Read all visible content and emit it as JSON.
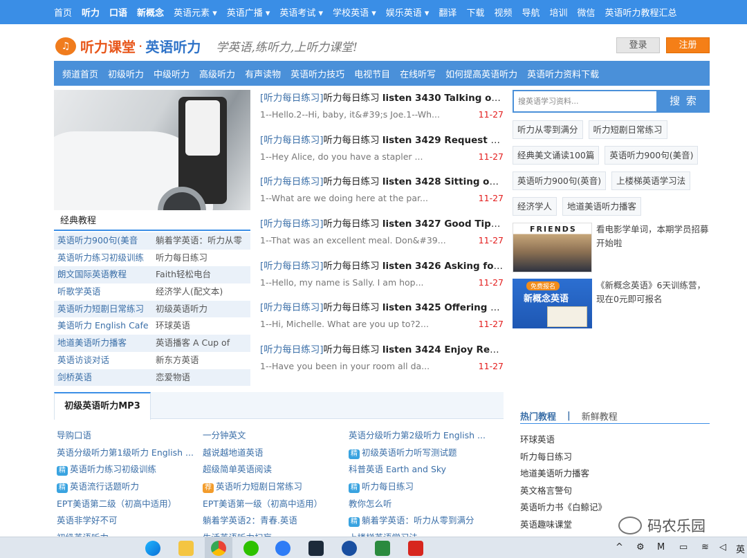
{
  "topnav": [
    "首页",
    "听力",
    "口语",
    "新概念",
    "英语元素 ▾",
    "英语广播 ▾",
    "英语考试 ▾",
    "学校英语 ▾",
    "娱乐英语 ▾",
    "翻译",
    "下载",
    "视频",
    "导航",
    "培训",
    "微信",
    "英语听力教程汇总"
  ],
  "logo": {
    "brand1": "听力课堂",
    "dot": "·",
    "brand2": "英语听力",
    "slogan": "学英语,练听力,上听力课堂!"
  },
  "auth": {
    "login": "登录",
    "register": "注册"
  },
  "channav": [
    "频道首页",
    "初级听力",
    "中级听力",
    "高级听力",
    "有声读物",
    "英语听力技巧",
    "电视节目",
    "在线听写",
    "如何提高英语听力",
    "英语听力资料下载"
  ],
  "classic": {
    "title": "经典教程",
    "rows": [
      [
        "英语听力900句(美音",
        "躺着学英语：听力从零"
      ],
      [
        "英语听力练习初级训练",
        "听力每日练习"
      ],
      [
        "朗文国际英语教程",
        "Faith轻松电台"
      ],
      [
        "听歌学英语",
        "经济学人(配文本)"
      ],
      [
        "英语听力短剧日常练习",
        "初级英语听力"
      ],
      [
        "美语听力 English Cafe",
        "环球英语"
      ],
      [
        "地道美语听力播客",
        "英语播客 A Cup of"
      ],
      [
        "英语访谈对话",
        "新东方英语"
      ],
      [
        "剑桥英语",
        "恋爱物语"
      ]
    ]
  },
  "news": [
    {
      "cat": "[听力每日练习]",
      "pre": "听力每日练习 ",
      "title": "listen 3430 Talking on t...",
      "sub": "1--Hello.2--Hi, baby, it&#39;s Joe.1--Wh...",
      "date": "11-27"
    },
    {
      "cat": "[听力每日练习]",
      "pre": "听力每日练习 ",
      "title": "listen 3429 Request for ...",
      "sub": "1--Hey Alice, do you have a stapler ...",
      "date": "11-27"
    },
    {
      "cat": "[听力每日练习]",
      "pre": "听力每日练习 ",
      "title": "listen 3428 Sitting on th...",
      "sub": "1--What are we doing here at the par...",
      "date": "11-27"
    },
    {
      "cat": "[听力每日练习]",
      "pre": "听力每日练习 ",
      "title": "listen 3427 Good Tips fo...",
      "sub": "1--That was an excellent meal. Don&#39...",
      "date": "11-27"
    },
    {
      "cat": "[听力每日练习]",
      "pre": "听力每日练习 ",
      "title": "listen 3426 Asking for H...",
      "sub": "1--Hello, my name is Sally. I am hop...",
      "date": "11-27"
    },
    {
      "cat": "[听力每日练习]",
      "pre": "听力每日练习 ",
      "title": "listen 3425 Offering Help",
      "sub": "1--Hi, Michelle. What are you up to?2...",
      "date": "11-27"
    },
    {
      "cat": "[听力每日练习]",
      "pre": "听力每日练习 ",
      "title": "listen 3424 Enjoy Reading",
      "sub": "1--Have you been in your room all da...",
      "date": "11-27"
    }
  ],
  "search": {
    "placeholder": "搜英语学习资料...",
    "button": "搜 索"
  },
  "tags": [
    [
      "听力从零到满分",
      "听力短剧日常练习"
    ],
    [
      "经典美文诵读100篇",
      "英语听力900句(美音)"
    ],
    [
      "英语听力900句(英音)",
      "上楼梯英语学习法"
    ],
    [
      "经济学人",
      "地道美语听力播客"
    ]
  ],
  "promos": [
    {
      "image_label": "FRIENDS",
      "text": "看电影学单词，本期学员招募开始啦"
    },
    {
      "image_badge": "免费报名",
      "image_label": "新概念英语",
      "text": "《新概念英语》6天训练营，现在0元即可报名"
    }
  ],
  "mp3": {
    "tab": "初级英语听力MP3",
    "col1": [
      {
        "text": "导购口语"
      },
      {
        "text": "英语分级听力第1级听力 English ..."
      },
      {
        "badge": "精",
        "text": "英语听力练习初级训练"
      },
      {
        "badge": "精",
        "text": "英语流行话题听力"
      },
      {
        "text": "EPT美语第二级（初高中适用）"
      },
      {
        "text": "英语非学好不可"
      },
      {
        "text": "初级英语听力"
      }
    ],
    "col2": [
      {
        "text": "一分钟英文"
      },
      {
        "text": "越说越地道英语"
      },
      {
        "text": "超级简单英语阅读"
      },
      {
        "badge": "荐",
        "badge_style": "orange",
        "text": "英语听力短剧日常练习"
      },
      {
        "text": "EPT美语第一级（初高中适用）"
      },
      {
        "text": "躺着学英语2：青春.英语"
      },
      {
        "text": "生活英语听力扫盲"
      }
    ],
    "col3": [
      {
        "text": "英语分级听力第2级听力 English ..."
      },
      {
        "badge": "精",
        "text": "初级英语听力听写测试题"
      },
      {
        "text": "科普英语 Earth and Sky"
      },
      {
        "badge": "精",
        "text": "听力每日练习"
      },
      {
        "text": "教你怎么听"
      },
      {
        "badge": "精",
        "text": "躺着学英语：听力从零到满分"
      },
      {
        "text": "上楼梯英语学习法"
      }
    ]
  },
  "hot": {
    "tab_active": "热门教程",
    "tab_sep": "|",
    "tab_other": "新鲜教程",
    "items": [
      "环球英语",
      "听力每日练习",
      "地道美语听力播客",
      "英文格言警句",
      "英语听力书《白鲸记》",
      "英语趣味课堂"
    ]
  },
  "watermark": "码农乐园",
  "taskbar": {
    "ime": "英"
  }
}
